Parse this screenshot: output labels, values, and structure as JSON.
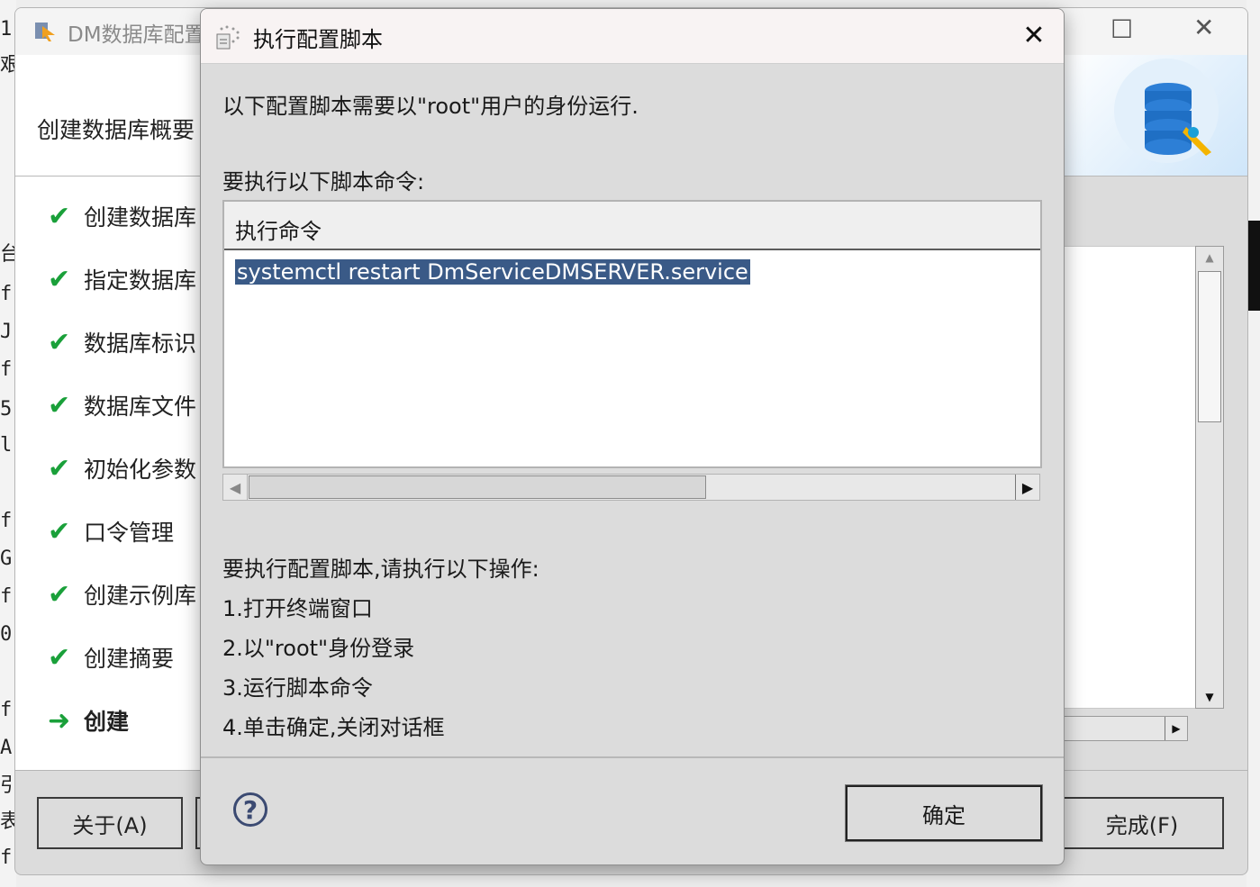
{
  "terminal_left": [
    "1",
    "艰",
    "台",
    "f",
    "J",
    "f",
    "5",
    "l",
    "f",
    "G",
    "f",
    "0",
    "f",
    "A",
    "引",
    "表",
    "f"
  ],
  "bg_window": {
    "title": "DM数据库配置",
    "header_title": "创建数据库概要",
    "steps": [
      {
        "label": "创建数据库",
        "marker": "✔",
        "state": "done"
      },
      {
        "label": "指定数据库",
        "marker": "✔",
        "state": "done"
      },
      {
        "label": "数据库标识",
        "marker": "✔",
        "state": "done"
      },
      {
        "label": "数据库文件",
        "marker": "✔",
        "state": "done"
      },
      {
        "label": "初始化参数",
        "marker": "✔",
        "state": "done"
      },
      {
        "label": "口令管理",
        "marker": "✔",
        "state": "done"
      },
      {
        "label": "创建示例库",
        "marker": "✔",
        "state": "done"
      },
      {
        "label": "创建摘要",
        "marker": "✔",
        "state": "done"
      },
      {
        "label": "创建",
        "marker": "➜",
        "state": "current"
      }
    ],
    "buttons": {
      "about": "关于(A)",
      "finish": "完成(F)"
    }
  },
  "dialog": {
    "title": "执行配置脚本",
    "intro": "以下配置脚本需要以\"root\"用户的身份运行.",
    "commands_label": "要执行以下脚本命令:",
    "table_header": "执行命令",
    "commands": [
      "systemctl restart DmServiceDMSERVER.service"
    ],
    "instructions_label": "要执行配置脚本,请执行以下操作:",
    "instructions": [
      "1.打开终端窗口",
      "2.以\"root\"身份登录",
      "3.运行脚本命令",
      "4.单击确定,关闭对话框"
    ],
    "ok_label": "确定",
    "help_label": "?"
  },
  "colors": {
    "check": "#1aa03a",
    "selection": "#3a5a87",
    "help": "#3b4a72"
  }
}
